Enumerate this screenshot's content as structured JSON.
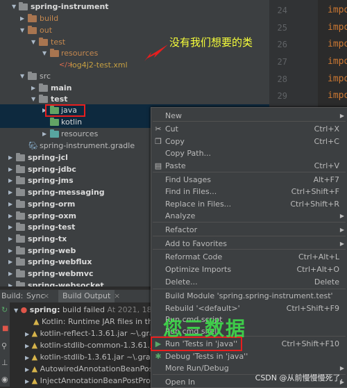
{
  "tree": {
    "root": "spring-instrument",
    "build": "build",
    "out": "out",
    "test1": "test",
    "resources1": "resources",
    "logfile": "log4j2-test.xml",
    "src": "src",
    "main": "main",
    "test2": "test",
    "java": "java",
    "kotlin": "kotlin",
    "resources2": "resources",
    "gradle": "spring-instrument.gradle",
    "modules": [
      "spring-jcl",
      "spring-jdbc",
      "spring-jms",
      "spring-messaging",
      "spring-orm",
      "spring-oxm",
      "spring-test",
      "spring-tx",
      "spring-web",
      "spring-webflux",
      "spring-webmvc",
      "spring-websocket"
    ]
  },
  "editor": {
    "lines": [
      "24",
      "25",
      "26",
      "27",
      "28",
      "29"
    ],
    "keyword": "impo"
  },
  "annotation": "没有我们想要的类",
  "build_panel": {
    "tabs": {
      "build": "Build:",
      "sync": "Sync",
      "output": "Build Output"
    },
    "status_module": "spring:",
    "status_text": "build failed",
    "status_time": "At 2021, 18 sec,",
    "items": [
      "Kotlin: Runtime JAR files in the",
      "kotlin-reflect-1.3.61.jar ~\\.gradl",
      "kotlin-stdlib-common-1.3.61.jar",
      "kotlin-stdlib-1.3.61.jar ~\\.gradle",
      "AutowiredAnnotationBeanPostP",
      "InjectAnnotationBeanPostProce"
    ]
  },
  "menu": {
    "items": [
      {
        "label": "New",
        "shortcut": "",
        "submenu": true,
        "icon": ""
      },
      {
        "label": "Cut",
        "shortcut": "Ctrl+X",
        "submenu": false,
        "icon": "✂"
      },
      {
        "label": "Copy",
        "shortcut": "Ctrl+C",
        "submenu": false,
        "icon": "❐"
      },
      {
        "label": "Copy Path...",
        "shortcut": "",
        "submenu": false,
        "icon": ""
      },
      {
        "label": "Paste",
        "shortcut": "Ctrl+V",
        "submenu": false,
        "icon": "▤"
      },
      {
        "label": "Find Usages",
        "shortcut": "Alt+F7",
        "submenu": false,
        "icon": ""
      },
      {
        "label": "Find in Files...",
        "shortcut": "Ctrl+Shift+F",
        "submenu": false,
        "icon": ""
      },
      {
        "label": "Replace in Files...",
        "shortcut": "Ctrl+Shift+R",
        "submenu": false,
        "icon": ""
      },
      {
        "label": "Analyze",
        "shortcut": "",
        "submenu": true,
        "icon": ""
      },
      {
        "label": "Refactor",
        "shortcut": "",
        "submenu": true,
        "icon": ""
      },
      {
        "label": "Add to Favorites",
        "shortcut": "",
        "submenu": true,
        "icon": ""
      },
      {
        "label": "Reformat Code",
        "shortcut": "Ctrl+Alt+L",
        "submenu": false,
        "icon": ""
      },
      {
        "label": "Optimize Imports",
        "shortcut": "Ctrl+Alt+O",
        "submenu": false,
        "icon": ""
      },
      {
        "label": "Delete...",
        "shortcut": "Delete",
        "submenu": false,
        "icon": ""
      },
      {
        "label": "Build Module 'spring.spring-instrument.test'",
        "shortcut": "",
        "submenu": false,
        "icon": ""
      },
      {
        "label": "Rebuild '<default>'",
        "shortcut": "Ctrl+Shift+F9",
        "submenu": false,
        "icon": ""
      },
      {
        "label": "Run cmd script",
        "shortcut": "",
        "submenu": false,
        "icon": ""
      },
      {
        "label": "Run cmd shell",
        "shortcut": "",
        "submenu": false,
        "icon": ""
      },
      {
        "label": "Run 'Tests in 'java''",
        "shortcut": "Ctrl+Shift+F10",
        "submenu": false,
        "icon": "▶"
      },
      {
        "label": "Debug 'Tests in 'java''",
        "shortcut": "",
        "submenu": false,
        "icon": "✱"
      },
      {
        "label": "More Run/Debug",
        "shortcut": "",
        "submenu": true,
        "icon": ""
      },
      {
        "label": "Open In",
        "shortcut": "",
        "submenu": true,
        "icon": ""
      }
    ]
  },
  "watermark": "您三数据",
  "credit": "CSDN @从前慢慢慢死了,",
  "colors": {
    "annotation": "#f7ff3a",
    "highlight_box": "#e81e1e",
    "run_icon": "#59a869",
    "debug_icon": "#59a869"
  }
}
